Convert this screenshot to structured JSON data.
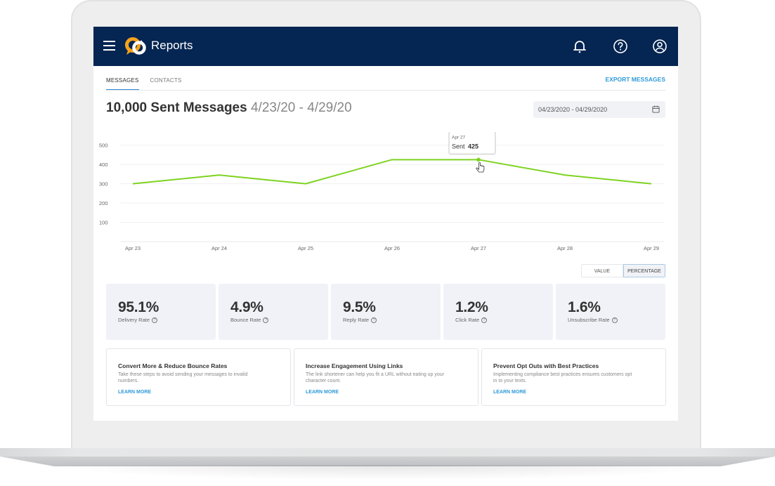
{
  "app": {
    "title": "Reports",
    "brand_color": "#052552",
    "accent_color": "#2f9ad8",
    "logo_colors": [
      "#f6a21b",
      "#ffffff"
    ]
  },
  "header_icons": [
    "menu-icon",
    "bell-icon",
    "help-icon",
    "account-icon"
  ],
  "tabs": [
    {
      "label": "MESSAGES",
      "active": true
    },
    {
      "label": "CONTACTS",
      "active": false
    }
  ],
  "export_label": "EXPORT MESSAGES",
  "headline": {
    "count": "10,000 Sent Messages",
    "range": "4/23/20 - 4/29/20"
  },
  "date_range_input": "04/23/2020 - 04/29/2020",
  "chart_data": {
    "type": "line",
    "x": [
      "Apr 23",
      "Apr 24",
      "Apr 25",
      "Apr 26",
      "Apr 27",
      "Apr 28",
      "Apr 29"
    ],
    "series": [
      {
        "name": "Sent",
        "values": [
          300,
          345,
          300,
          425,
          425,
          345,
          300
        ],
        "color": "#7ed321"
      }
    ],
    "yticks": [
      100,
      200,
      300,
      400,
      500
    ],
    "ylim": [
      0,
      550
    ],
    "grid": true,
    "tooltip": {
      "x_label": "Apr 27",
      "series": "Sent",
      "value": "425"
    },
    "title": "",
    "xlabel": "",
    "ylabel": ""
  },
  "view_toggle": {
    "options": [
      "VALUE",
      "PERCENTAGE"
    ],
    "selected": "PERCENTAGE"
  },
  "stats": [
    {
      "value": "95.1%",
      "label": "Delivery Rate"
    },
    {
      "value": "4.9%",
      "label": "Bounce Rate"
    },
    {
      "value": "9.5%",
      "label": "Reply Rate"
    },
    {
      "value": "1.2%",
      "label": "Click Rate"
    },
    {
      "value": "1.6%",
      "label": "Unsubscribe Rate"
    }
  ],
  "tips": [
    {
      "title": "Convert More & Reduce Bounce Rates",
      "desc": "Take these steps to avoid sending your messages to invalid numbers.",
      "link": "LEARN MORE"
    },
    {
      "title": "Increase Engagement Using Links",
      "desc": "The link shortener can help you fit a URL without eating up your character count.",
      "link": "LEARN MORE"
    },
    {
      "title": "Prevent Opt Outs with Best Practices",
      "desc": "Implementing compliance best practices ensures customers opt in to your texts.",
      "link": "LEARN MORE"
    }
  ]
}
